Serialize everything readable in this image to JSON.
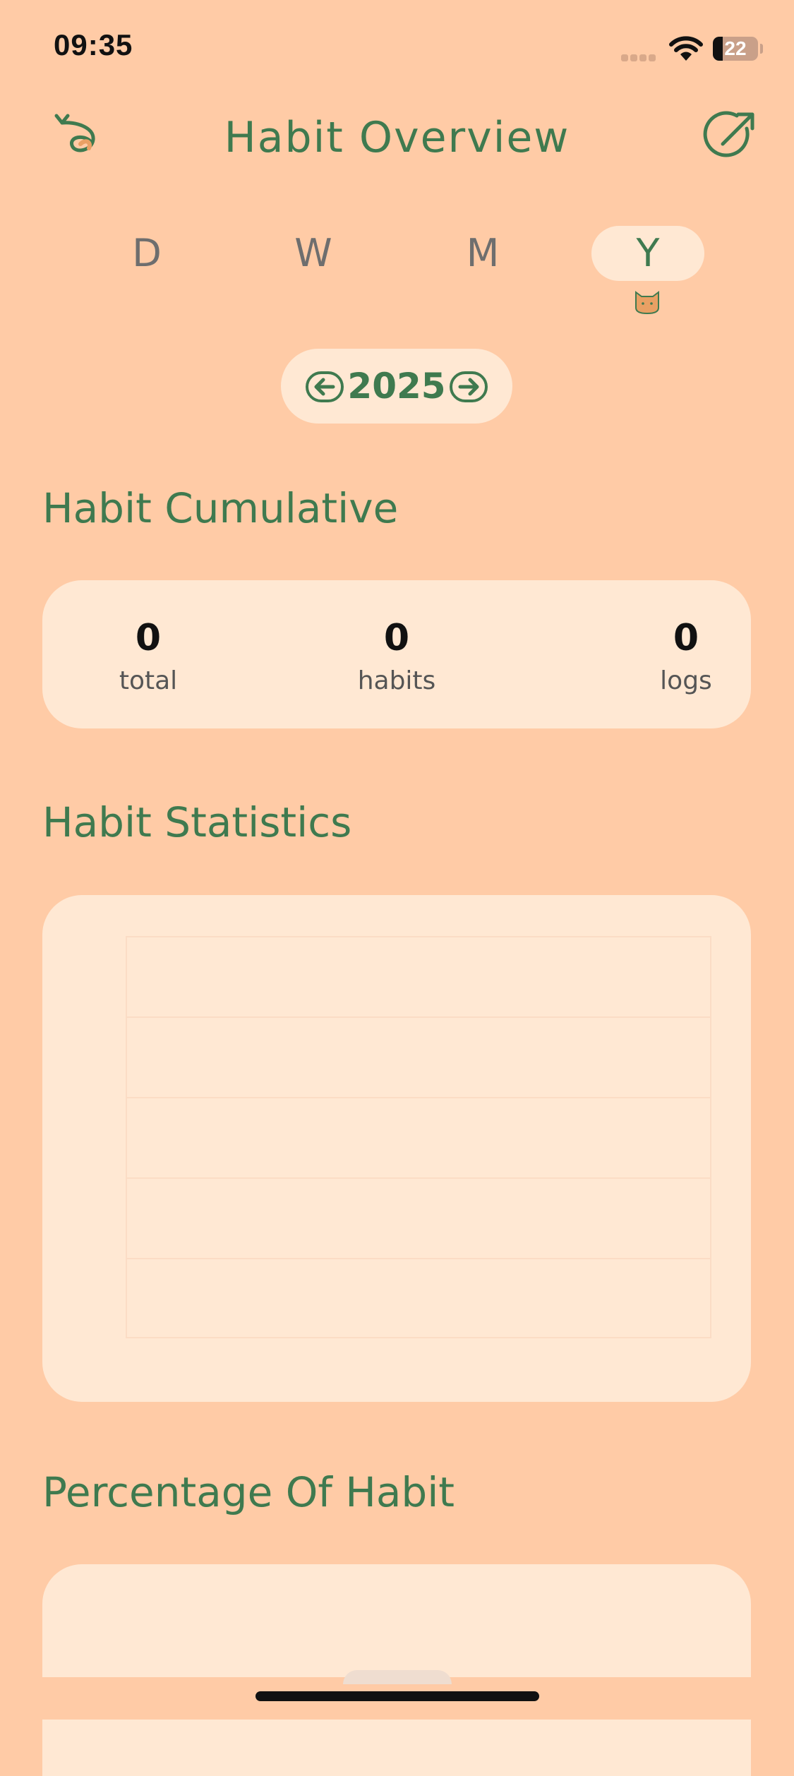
{
  "status_bar": {
    "time": "09:35",
    "battery": "22"
  },
  "header": {
    "title": "Habit Overview",
    "back_icon": "back-arrow-icon",
    "share_icon": "share-icon"
  },
  "period_tabs": {
    "items": [
      "D",
      "W",
      "M",
      "Y"
    ],
    "selected": "Y"
  },
  "year_selector": {
    "year": "2025",
    "prev_icon": "arrow-left-circle-icon",
    "next_icon": "arrow-right-circle-icon"
  },
  "cumulative": {
    "title": "Habit Cumulative",
    "stats": [
      {
        "value": "0",
        "label": "total"
      },
      {
        "value": "0",
        "label": "habits"
      },
      {
        "value": "0",
        "label": "logs"
      }
    ]
  },
  "statistics": {
    "title": "Habit Statistics"
  },
  "percentage": {
    "title": "Percentage Of Habit"
  },
  "colors": {
    "background": "#FFCBA6",
    "card": "#FFE8D3",
    "accent": "#3F7A4F",
    "cat": "#E9A064"
  }
}
